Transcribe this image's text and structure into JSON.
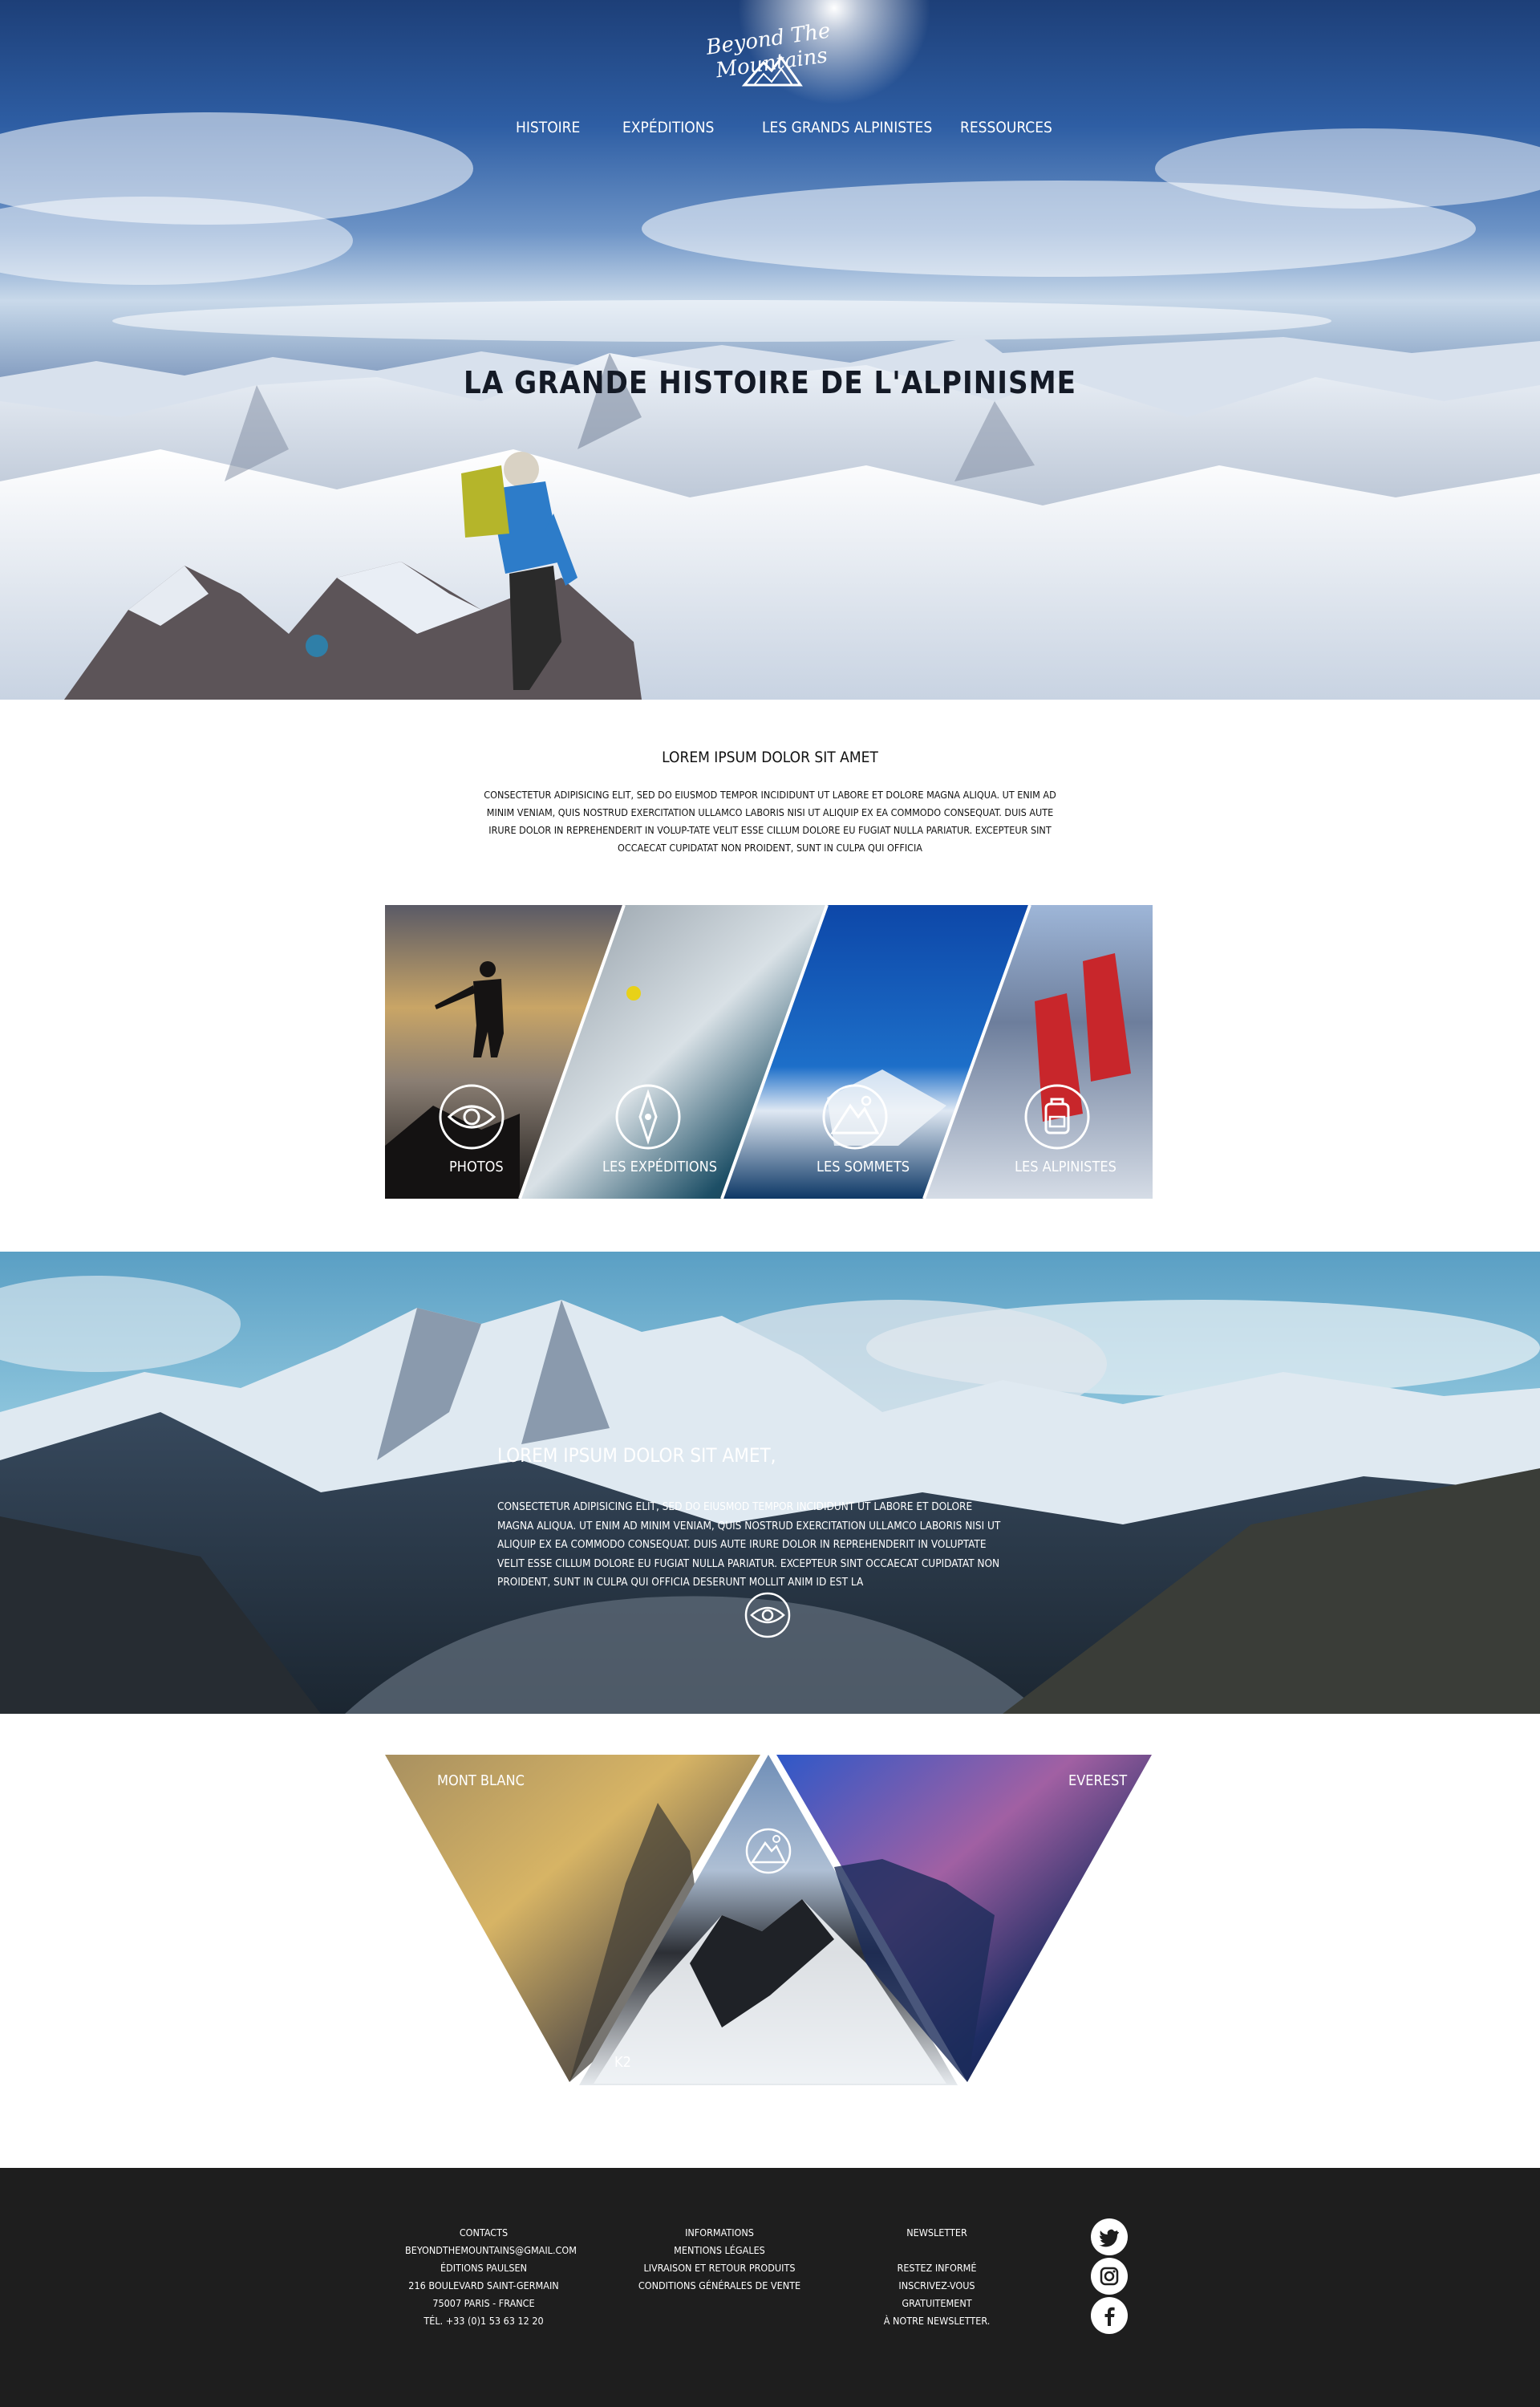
{
  "header": {
    "logo_text": "Beyond The Mountains",
    "nav": [
      "HISTOIRE",
      "EXPÉDITIONS",
      "LES GRANDS ALPINISTES",
      "RESSOURCES"
    ],
    "hero_title": "LA GRANDE HISTOIRE DE L'ALPINISME"
  },
  "intro": {
    "heading": "LOREM IPSUM DOLOR SIT AMET",
    "text": "CONSECTETUR ADIPISICING ELIT, SED DO EIUSMOD TEMPOR INCIDIDUNT UT LABORE ET DOLORE MAGNA ALIQUA. UT ENIM AD MINIM VENIAM, QUIS NOSTRUD EXERCITATION ULLAMCO LABORIS NISI UT ALIQUIP EX EA COMMODO CONSEQUAT. DUIS AUTE IRURE DOLOR IN REPREHENDERIT IN VOLUP-TATE VELIT ESSE CILLUM DOLORE EU FUGIAT NULLA PARIATUR. EXCEPTEUR SINT OCCAECAT CUPIDATAT NON PROIDENT, SUNT IN CULPA QUI OFFICIA"
  },
  "categories": [
    {
      "label": "PHOTOS",
      "icon": "eye-icon"
    },
    {
      "label": "LES EXPÉDITIONS",
      "icon": "compass-icon"
    },
    {
      "label": "LES SOMMETS",
      "icon": "mountain-icon"
    },
    {
      "label": "LES ALPINISTES",
      "icon": "backpack-icon"
    }
  ],
  "banner": {
    "heading": "LOREM IPSUM DOLOR SIT AMET,",
    "text": "CONSECTETUR ADIPISICING ELIT, SED DO EIUSMOD TEMPOR INCIDIDUNT UT LABORE ET DOLORE MAGNA ALIQUA. UT ENIM AD MINIM VENIAM, QUIS NOSTRUD EXERCITATION ULLAMCO LABORIS NISI UT ALIQUIP EX EA COMMODO CONSEQUAT. DUIS AUTE IRURE DOLOR IN REPREHENDERIT IN VOLUPTATE VELIT ESSE CILLUM DOLORE EU FUGIAT NULLA PARIATUR. EXCEPTEUR SINT OCCAECAT CUPIDATAT NON PROIDENT, SUNT IN CULPA QUI OFFICIA DESERUNT MOLLIT ANIM ID EST LA"
  },
  "mountains": {
    "left": "MONT BLANC",
    "center": "K2",
    "right": "EVEREST"
  },
  "footer": {
    "contacts": {
      "title": "CONTACTS",
      "email": "BEYONDTHEMOUNTAINS@GMAIL.COM",
      "company": "ÉDITIONS PAULSEN",
      "address": "216 BOULEVARD SAINT-GERMAIN",
      "city": "75007 PARIS - FRANCE",
      "phone": "TÉL. +33 (0)1 53 63 12 20"
    },
    "informations": {
      "title": "INFORMATIONS",
      "links": [
        "MENTIONS LÉGALES",
        "LIVRAISON ET RETOUR PRODUITS",
        "CONDITIONS GÉNÉRALES DE VENTE"
      ]
    },
    "newsletter": {
      "title": "NEWSLETTER",
      "lines": [
        "RESTEZ INFORMÉ",
        "INSCRIVEZ-VOUS GRATUITEMENT",
        "À NOTRE NEWSLETTER."
      ]
    },
    "social": [
      "twitter-icon",
      "instagram-icon",
      "facebook-icon"
    ]
  }
}
